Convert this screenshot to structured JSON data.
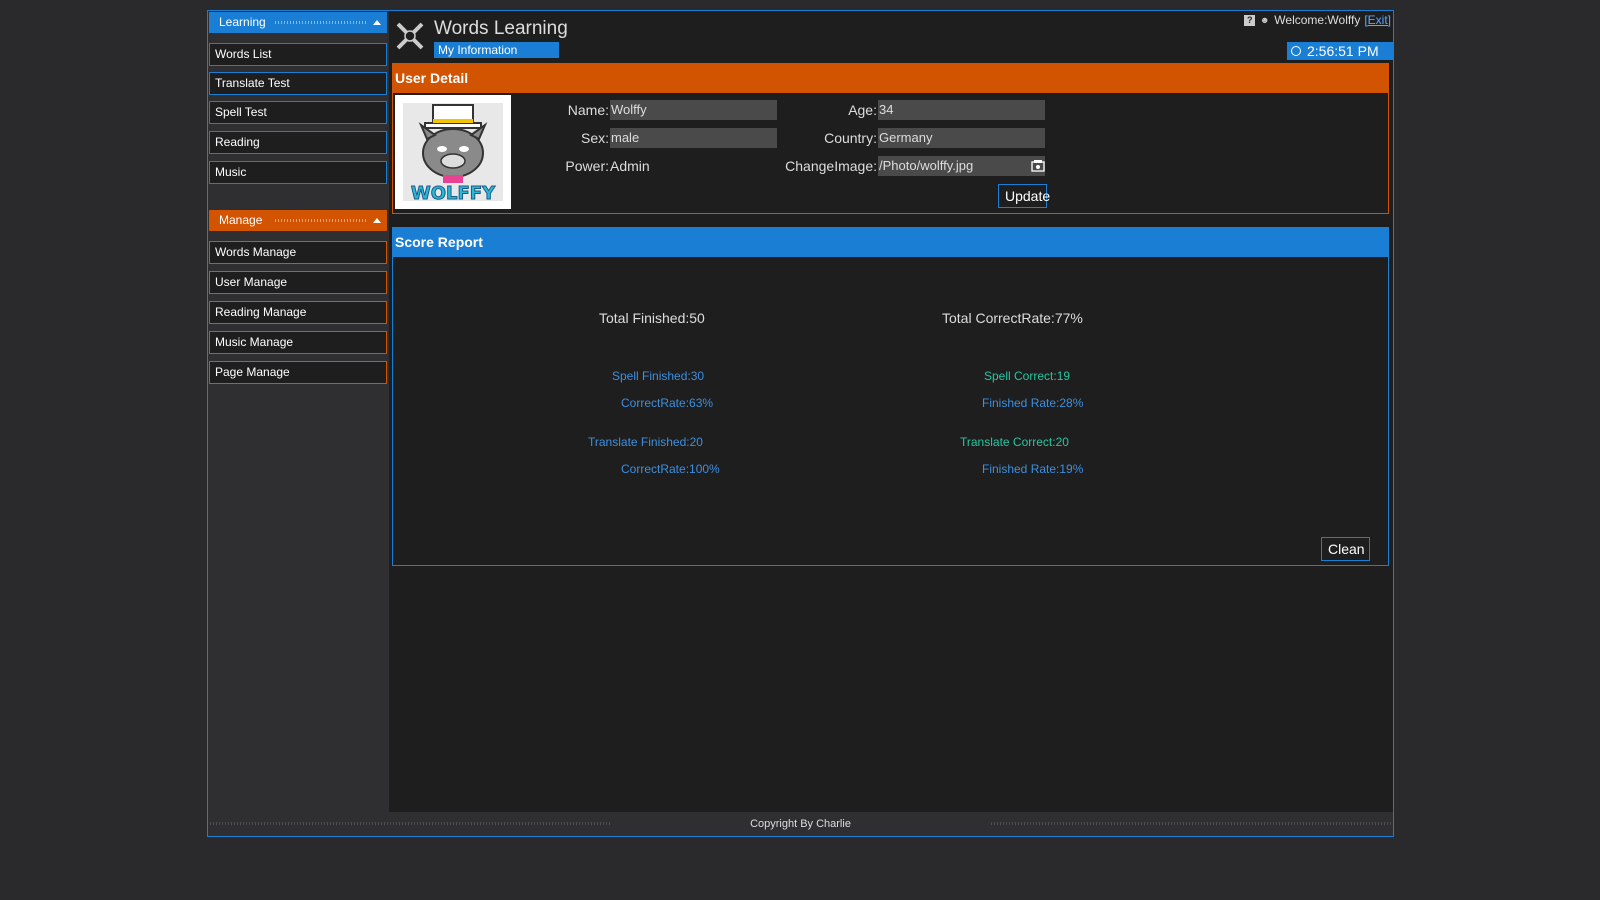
{
  "app": {
    "title": "Words Learning",
    "subtab": "My Information"
  },
  "topbar": {
    "welcome": "Welcome:Wolffy",
    "exit_label": "[Exit]",
    "time": "2:56:51 PM"
  },
  "sidebar": {
    "learning": {
      "header": "Learning",
      "items": [
        "Words List",
        "Translate Test",
        "Spell Test",
        "Reading",
        "Music"
      ]
    },
    "manage": {
      "header": "Manage",
      "items": [
        "Words Manage",
        "User Manage",
        "Reading Manage",
        "Music Manage",
        "Page Manage"
      ]
    }
  },
  "user_detail": {
    "title": "User Detail",
    "avatar_text": "WOLFFY",
    "name_label": "Name:",
    "name_value": "Wolffy",
    "sex_label": "Sex:",
    "sex_value": "male",
    "power_label": "Power:",
    "power_value": "Admin",
    "age_label": "Age:",
    "age_value": "34",
    "country_label": "Country:",
    "country_value": "Germany",
    "image_label": "ChangeImage:",
    "image_value": "/Photo/wolffy.jpg",
    "update_label": "Update"
  },
  "score_report": {
    "title": "Score Report",
    "total_finished": "Total Finished:50",
    "total_correct_rate": "Total CorrectRate:77%",
    "spell_finished": "Spell Finished:30",
    "spell_correct_rate": "CorrectRate:63%",
    "spell_correct": "Spell Correct:19",
    "spell_finished_rate": "Finished Rate:28%",
    "translate_finished": "Translate Finished:20",
    "translate_correct_rate": "CorrectRate:100%",
    "translate_correct": "Translate Correct:20",
    "translate_finished_rate": "Finished Rate:19%",
    "clean_label": "Clean"
  },
  "footer": {
    "copyright": "Copyright By Charlie"
  },
  "colors": {
    "accent_blue": "#1a7fd4",
    "accent_orange": "#d35400",
    "stat_blue": "#3d8fe0",
    "stat_green": "#26c6a0"
  }
}
